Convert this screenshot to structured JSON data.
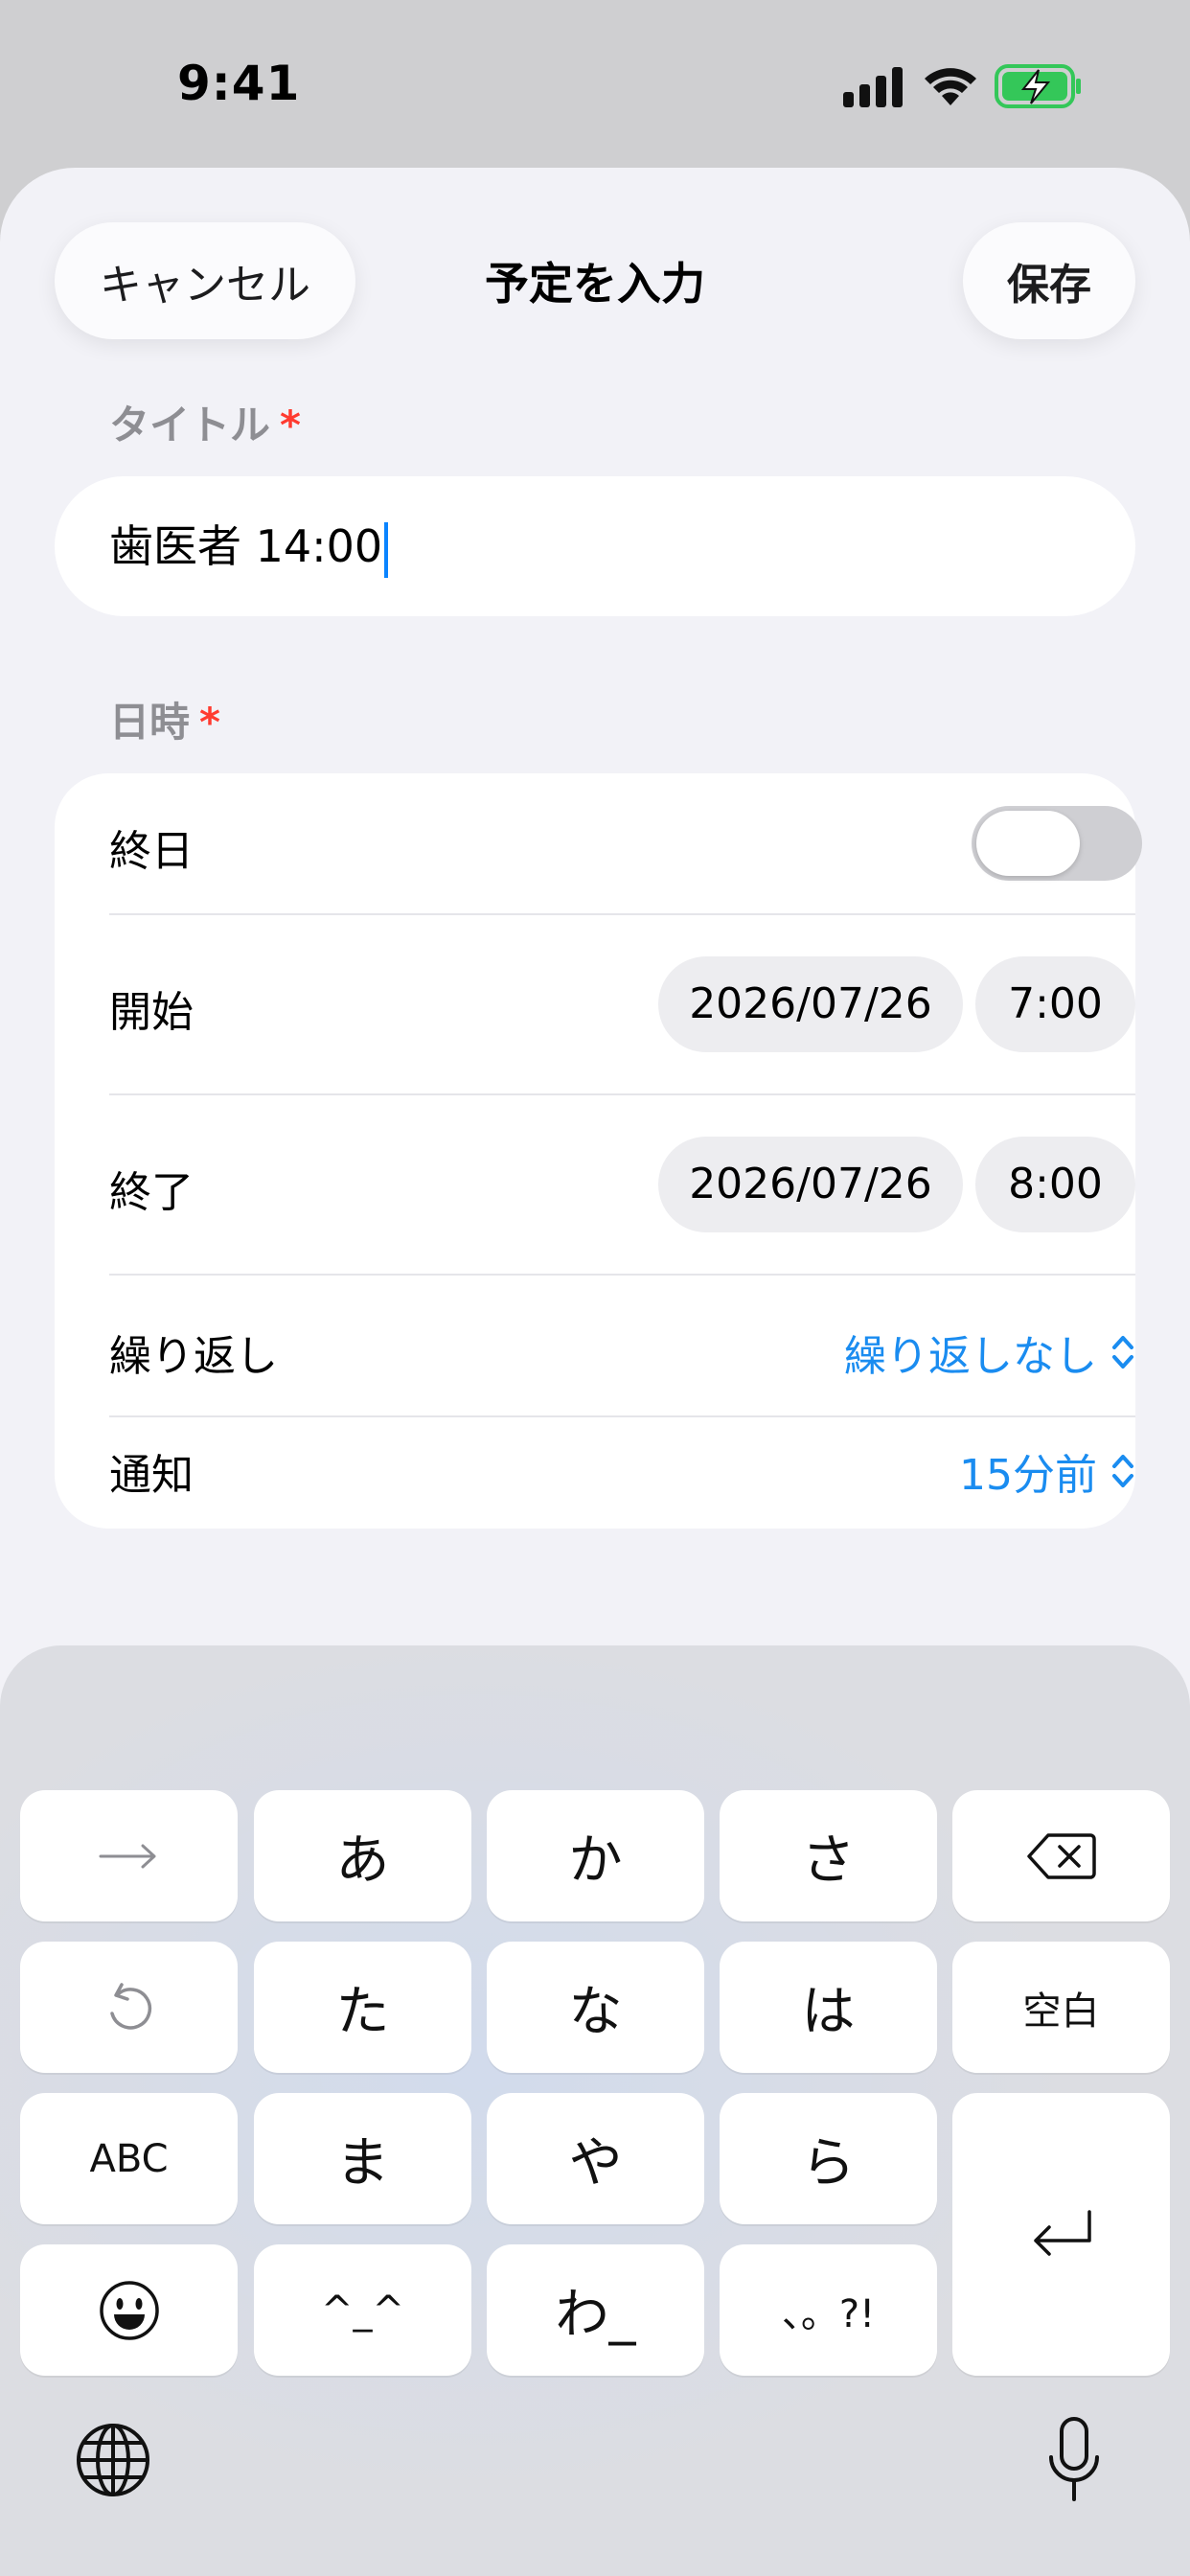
{
  "status_bar": {
    "time": "9:41",
    "icons": [
      "cellular-signal-icon",
      "wifi-icon",
      "battery-charging-icon"
    ]
  },
  "header": {
    "cancel_label": "キャンセル",
    "title": "予定を入力",
    "save_label": "保存"
  },
  "title_section": {
    "label": "タイトル",
    "required_mark": "*",
    "value": "歯医者 14:00"
  },
  "datetime_section": {
    "label": "日時",
    "required_mark": "*",
    "all_day": {
      "label": "終日",
      "on": false
    },
    "start": {
      "label": "開始",
      "date": "2026/07/26",
      "time": "7:00"
    },
    "end": {
      "label": "終了",
      "date": "2026/07/26",
      "time": "8:00"
    },
    "repeat": {
      "label": "繰り返し",
      "value": "繰り返しなし"
    },
    "notification": {
      "label": "通知",
      "value": "15分前"
    }
  },
  "colors": {
    "accent": "#1a8cf0",
    "required": "#ff3b30",
    "background": "#f2f2f7"
  },
  "keyboard": {
    "row1": [
      "→",
      "あ",
      "か",
      "さ",
      "delete-icon"
    ],
    "row2": [
      "undo-icon",
      "た",
      "な",
      "は",
      "空白"
    ],
    "row3": [
      "ABC",
      "ま",
      "や",
      "ら"
    ],
    "row4": [
      "emoji-icon",
      "^_^",
      "わ_",
      "、。?!"
    ],
    "return": "return-icon",
    "bottom": [
      "globe-icon",
      "microphone-icon"
    ]
  }
}
